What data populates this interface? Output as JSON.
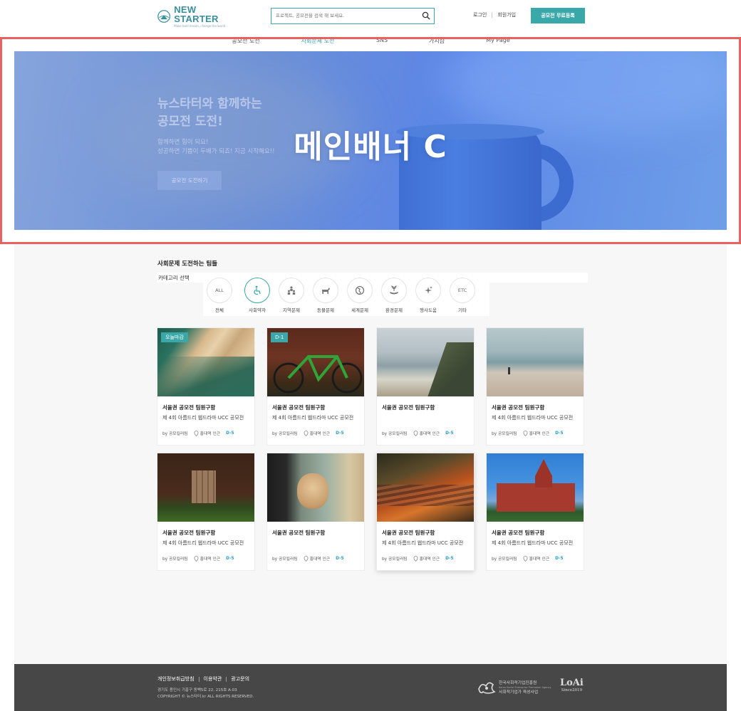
{
  "header": {
    "logo_name": "NEW STARTER",
    "logo_tagline": "Make bold dream, change the world",
    "search_placeholder": "프로젝트, 공모전을 검색 해 보세요.",
    "login": "로그인",
    "signup": "회원가입",
    "register_button": "공모전 무료등록"
  },
  "nav": {
    "items": [
      "공모전 도전",
      "사회문제 도전",
      "SNS",
      "가치샵",
      "My Page"
    ],
    "active_index": 1
  },
  "banner": {
    "title": "메인배너 C",
    "headline_1": "뉴스타터와 함께하는",
    "headline_2": "공모전 도전!",
    "desc_1": "함께하면 힘이 되요!",
    "desc_2": "성공하면 기쁨이 두배가 되죠! 지금 시작해요!!",
    "cta": "공모전 도전하기"
  },
  "section": {
    "title": "사회문제 도전하는 팀들",
    "category_label": "카테고리 선택"
  },
  "categories": [
    {
      "label": "전체",
      "icon": "ALL",
      "active": false
    },
    {
      "label": "사회약자",
      "icon": "wheelchair-icon",
      "active": true
    },
    {
      "label": "지역문제",
      "icon": "community-icon",
      "active": false
    },
    {
      "label": "동물문제",
      "icon": "dog-icon",
      "active": false
    },
    {
      "label": "세계문제",
      "icon": "globe-icon",
      "active": false
    },
    {
      "label": "환경문제",
      "icon": "plant-hand-icon",
      "active": false
    },
    {
      "label": "행사도움",
      "icon": "sparkle-icon",
      "active": false
    },
    {
      "label": "기타",
      "icon": "ETC",
      "active": false
    }
  ],
  "cards": [
    {
      "badge": "오늘마감",
      "title": "서울권 공모전 팀원구함",
      "subtitle": "제 4회 아름드리 웹드라마 UCC 공모전",
      "by": "by 공모킬러팀",
      "location": "홍대역 인근",
      "dday": "D-5",
      "image": "beach-aerial"
    },
    {
      "badge": "D-1",
      "title": "서울권 공모전 팀원구함",
      "subtitle": "제 4회 아름드리 웹드라마 UCC 공모전",
      "by": "by 공모킬러팀",
      "location": "홍대역 인근",
      "dday": "D-5",
      "image": "green-bicycle"
    },
    {
      "badge": "",
      "title": "서울권 공모전 팀원구함",
      "subtitle": "",
      "by": "by 공모킬러팀",
      "location": "홍대역 인근",
      "dday": "D-5",
      "image": "coast-cliff"
    },
    {
      "badge": "",
      "title": "서울권 공모전 팀원구함",
      "subtitle": "제 4회 아름드리 웹드라마 UCC 공모전",
      "by": "by 공모킬러팀",
      "location": "홍대역 인근",
      "dday": "D-5",
      "image": "beach-runner"
    },
    {
      "badge": "",
      "title": "서울권 공모전 팀원구함",
      "subtitle": "제 4회 아름드리 웹드라마 UCC 공모전",
      "by": "by 공모킬러팀",
      "location": "홍대역 인근",
      "dday": "D-5",
      "image": "wooden-door"
    },
    {
      "badge": "",
      "title": "서울권 공모전 팀원구함",
      "subtitle": "",
      "by": "by 공모킬러팀",
      "location": "홍대역 인근",
      "dday": "D-5",
      "image": "dog-window"
    },
    {
      "badge": "",
      "title": "서울권 공모전 팀원구함",
      "subtitle": "제 4회 아름드리 웹드라마 UCC 공모전",
      "by": "by 공모킬러팀",
      "location": "홍대역 인근",
      "dday": "D-5",
      "image": "autumn-roof"
    },
    {
      "badge": "",
      "title": "서울권 공모전 팀원구함",
      "subtitle": "제 4회 아름드리 웹드라마 UCC 공모전",
      "by": "by 공모킬러팀",
      "location": "홍대역 인근",
      "dday": "D-5",
      "image": "victorian-house"
    }
  ],
  "footer": {
    "links": [
      "개인정보취급방침",
      "이용약관",
      "광고문의"
    ],
    "address": "경기도 용인시 기흥구 동백5로 22, 215호 A-03",
    "copyright": "COPYRIGHT © 뉴스타터.kr ALL RIGHTS RESERVED.",
    "agency_name": "한국사회적기업진흥원",
    "agency_name_en": "Korea Social Enterprise Promotion Agency",
    "agency_program": "사회적기업가 육성사업",
    "partner_logo": "LoAi",
    "partner_since": "Since2019"
  },
  "colors": {
    "accent": "#3aa8a8",
    "dday": "#2a9fd0",
    "banner_border": "#e86264",
    "footer_bg": "#474747"
  }
}
